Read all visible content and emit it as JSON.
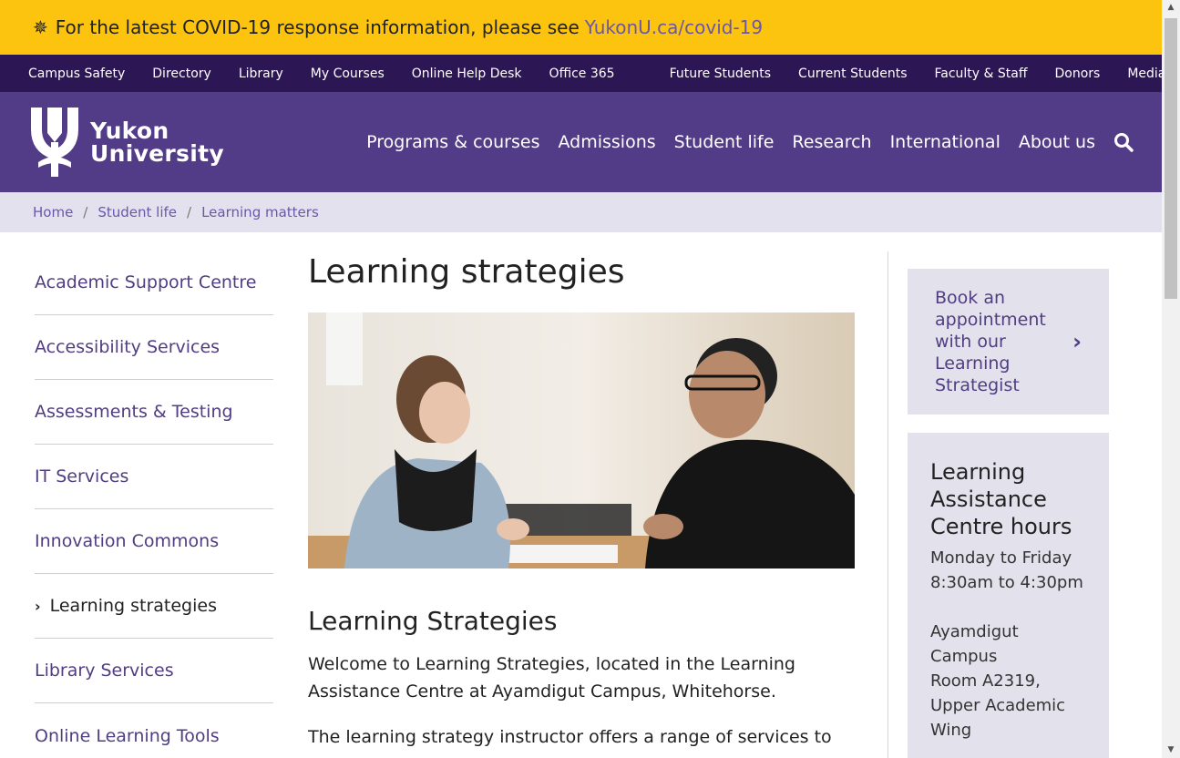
{
  "alert": {
    "icon": "gear-icon",
    "text": "For the latest COVID-19 response information, please see",
    "link": "YukonU.ca/covid-19"
  },
  "utility": {
    "left": [
      "Campus Safety",
      "Directory",
      "Library",
      "My Courses",
      "Online Help Desk",
      "Office 365"
    ],
    "right": [
      "Future Students",
      "Current Students",
      "Faculty & Staff",
      "Donors",
      "Media"
    ]
  },
  "header": {
    "logo_line1": "Yukon",
    "logo_line2": "University",
    "nav": [
      "Programs & courses",
      "Admissions",
      "Student life",
      "Research",
      "International",
      "About us"
    ]
  },
  "breadcrumb": [
    "Home",
    "Student life",
    "Learning matters"
  ],
  "sidenav": {
    "items": [
      "Academic Support Centre",
      "Accessibility Services",
      "Assessments & Testing",
      "IT Services",
      "Innovation Commons",
      "Learning strategies",
      "Library Services",
      "Online Learning Tools"
    ]
  },
  "main": {
    "title": "Learning strategies",
    "subtitle": "Learning Strategies",
    "para1": "Welcome to Learning Strategies, located in the Learning Assistance Centre at Ayamdigut Campus, Whitehorse.",
    "para2": "The learning strategy instructor offers a range of services to"
  },
  "aside": {
    "book": "Book an appointment with our Learning Strategist",
    "hours_title": "Learning Assistance Centre hours",
    "hours_days": "Monday to Friday",
    "hours_time": "8:30am to 4:30pm",
    "loc1": "Ayamdigut Campus",
    "loc2": "Room A2319,",
    "loc3": "Upper Academic",
    "loc4": "Wing"
  },
  "colors": {
    "alert": "#fcc30f",
    "utility": "#2d1654",
    "header": "#523b87",
    "breadcrumb": "#e4e1ef",
    "link": "#6b57a8"
  }
}
